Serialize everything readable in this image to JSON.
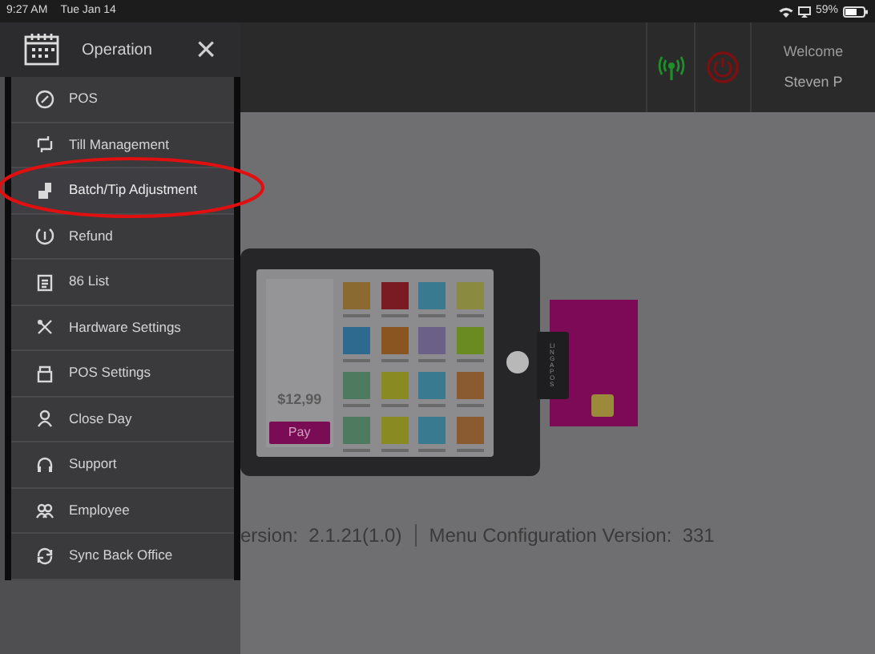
{
  "status_bar": {
    "time": "9:27 AM",
    "date": "Tue Jan 14",
    "battery": "59%"
  },
  "top_bar": {
    "welcome": "Welcome",
    "user": "Steven P"
  },
  "sidebar": {
    "title": "Operation",
    "close": "×",
    "items": [
      {
        "label": "POS",
        "selected": false
      },
      {
        "label": "Till Management",
        "selected": false
      },
      {
        "label": "Batch/Tip Adjustment",
        "selected": true
      },
      {
        "label": "Refund",
        "selected": false
      },
      {
        "label": "86 List",
        "selected": false
      },
      {
        "label": "Hardware Settings",
        "selected": false
      },
      {
        "label": "POS Settings",
        "selected": false
      },
      {
        "label": "Close Day",
        "selected": false
      },
      {
        "label": "Support",
        "selected": false
      },
      {
        "label": "Employee",
        "selected": false
      },
      {
        "label": "Sync Back Office",
        "selected": false
      }
    ]
  },
  "illustration": {
    "price": "$12,99",
    "pay": "Pay",
    "reader_label": "LINGA POS"
  },
  "footer": {
    "app_version": "ersion:  2.1.21(1.0)",
    "menu_version": "Menu Configuration Version:  331"
  }
}
